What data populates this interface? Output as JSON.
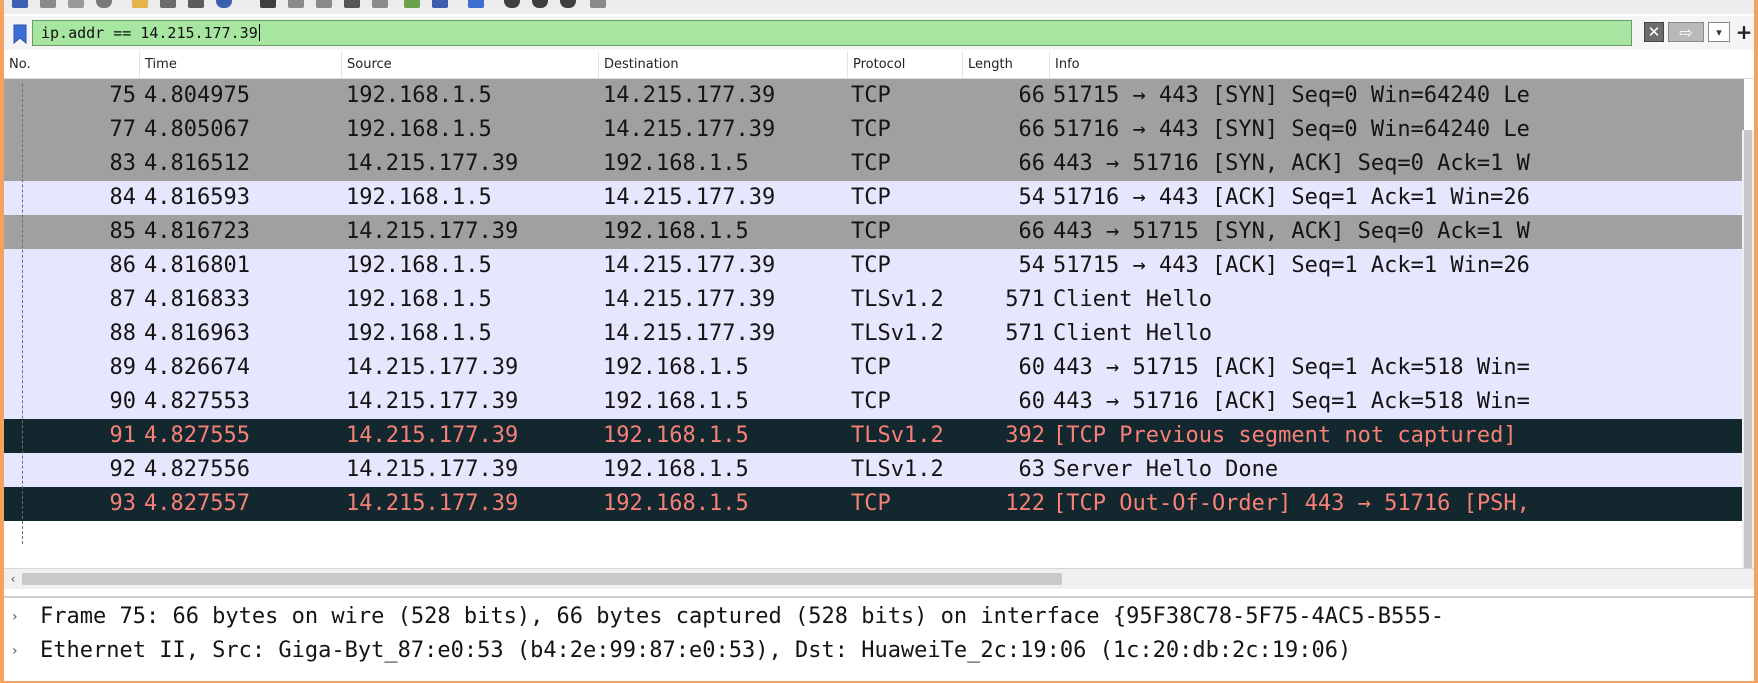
{
  "filter": {
    "value": "ip.addr == 14.215.177.39",
    "clear_label": "✕",
    "apply_label": "⇨",
    "history_label": "▾",
    "add_label": "+"
  },
  "columns": [
    "No.",
    "Time",
    "Source",
    "Destination",
    "Protocol",
    "Length",
    "Info"
  ],
  "packets": [
    {
      "no": "75",
      "time": "4.804975",
      "source": "192.168.1.5",
      "destination": "14.215.177.39",
      "protocol": "TCP",
      "length": "66",
      "info": "51715 → 443 [SYN] Seq=0 Win=64240 Le",
      "style": "gray"
    },
    {
      "no": "77",
      "time": "4.805067",
      "source": "192.168.1.5",
      "destination": "14.215.177.39",
      "protocol": "TCP",
      "length": "66",
      "info": "51716 → 443 [SYN] Seq=0 Win=64240 Le",
      "style": "gray"
    },
    {
      "no": "83",
      "time": "4.816512",
      "source": "14.215.177.39",
      "destination": "192.168.1.5",
      "protocol": "TCP",
      "length": "66",
      "info": "443 → 51716 [SYN, ACK] Seq=0 Ack=1 W",
      "style": "gray"
    },
    {
      "no": "84",
      "time": "4.816593",
      "source": "192.168.1.5",
      "destination": "14.215.177.39",
      "protocol": "TCP",
      "length": "54",
      "info": "51716 → 443 [ACK] Seq=1 Ack=1 Win=26",
      "style": "light"
    },
    {
      "no": "85",
      "time": "4.816723",
      "source": "14.215.177.39",
      "destination": "192.168.1.5",
      "protocol": "TCP",
      "length": "66",
      "info": "443 → 51715 [SYN, ACK] Seq=0 Ack=1 W",
      "style": "gray"
    },
    {
      "no": "86",
      "time": "4.816801",
      "source": "192.168.1.5",
      "destination": "14.215.177.39",
      "protocol": "TCP",
      "length": "54",
      "info": "51715 → 443 [ACK] Seq=1 Ack=1 Win=26",
      "style": "light"
    },
    {
      "no": "87",
      "time": "4.816833",
      "source": "192.168.1.5",
      "destination": "14.215.177.39",
      "protocol": "TLSv1.2",
      "length": "571",
      "info": "Client Hello",
      "style": "light"
    },
    {
      "no": "88",
      "time": "4.816963",
      "source": "192.168.1.5",
      "destination": "14.215.177.39",
      "protocol": "TLSv1.2",
      "length": "571",
      "info": "Client Hello",
      "style": "light"
    },
    {
      "no": "89",
      "time": "4.826674",
      "source": "14.215.177.39",
      "destination": "192.168.1.5",
      "protocol": "TCP",
      "length": "60",
      "info": "443 → 51715 [ACK] Seq=1 Ack=518 Win=",
      "style": "light"
    },
    {
      "no": "90",
      "time": "4.827553",
      "source": "14.215.177.39",
      "destination": "192.168.1.5",
      "protocol": "TCP",
      "length": "60",
      "info": "443 → 51716 [ACK] Seq=1 Ack=518 Win=",
      "style": "light"
    },
    {
      "no": "91",
      "time": "4.827555",
      "source": "14.215.177.39",
      "destination": "192.168.1.5",
      "protocol": "TLSv1.2",
      "length": "392",
      "info": "[TCP Previous segment not captured] ",
      "style": "bad"
    },
    {
      "no": "92",
      "time": "4.827556",
      "source": "14.215.177.39",
      "destination": "192.168.1.5",
      "protocol": "TLSv1.2",
      "length": "63",
      "info": "Server Hello Done",
      "style": "light"
    },
    {
      "no": "93",
      "time": "4.827557",
      "source": "14.215.177.39",
      "destination": "192.168.1.5",
      "protocol": "TCP",
      "length": "122",
      "info": "[TCP Out-Of-Order] 443 → 51716 [PSH,",
      "style": "bad"
    }
  ],
  "details": [
    {
      "expander": "›",
      "text": "Frame 75: 66 bytes on wire (528 bits), 66 bytes captured (528 bits) on interface {95F38C78-5F75-4AC5-B555-"
    },
    {
      "expander": "›",
      "text": "Ethernet II, Src: Giga-Byt_87:e0:53 (b4:2e:99:87:e0:53), Dst: HuaweiTe_2c:19:06 (1c:20:db:2c:19:06)"
    }
  ],
  "scroll_left_label": "‹",
  "icons": {
    "bookmark": "bookmark-icon",
    "clear": "clear-filter-icon",
    "apply": "apply-filter-arrow-icon",
    "history": "chevron-down-icon",
    "add": "plus-icon"
  }
}
